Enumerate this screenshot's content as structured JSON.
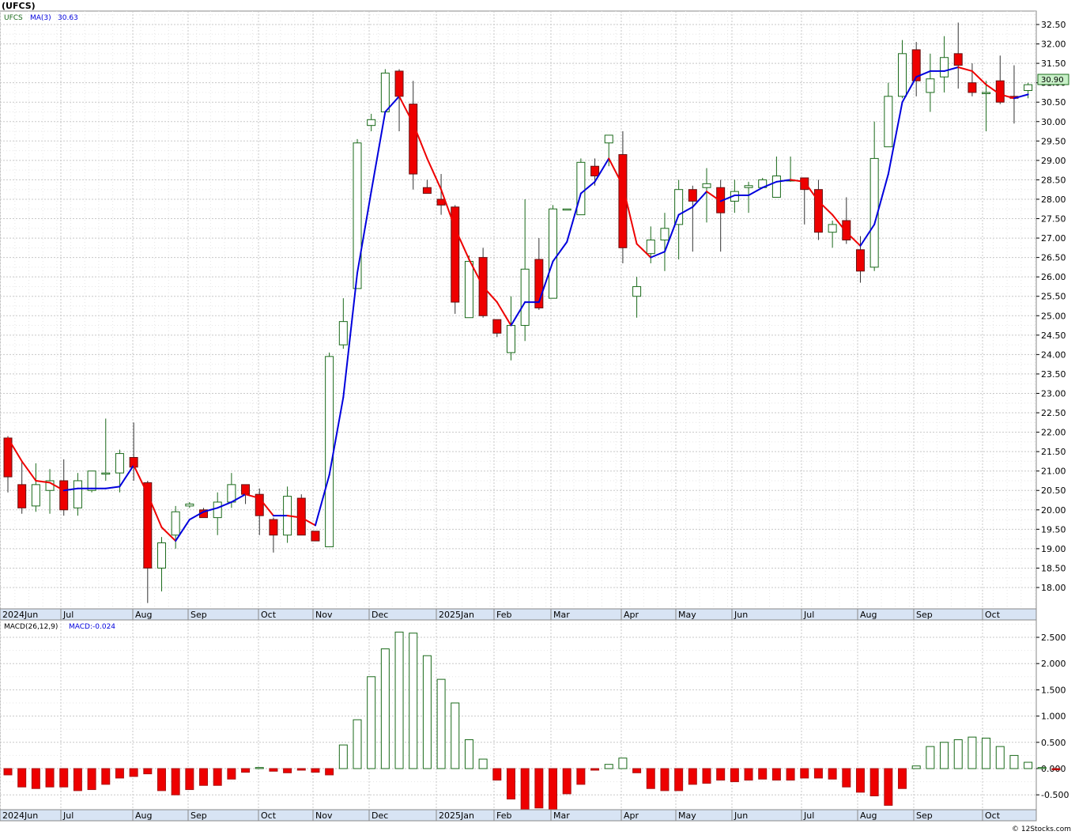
{
  "header": {
    "symbol_title": "(UFCS)"
  },
  "price_panel": {
    "legend_symbol": "UFCS",
    "ma_label": "MA(3)",
    "ma_value": "30.63",
    "last_price_label": "30.90"
  },
  "macd_panel": {
    "legend_params": "MACD(26,12,9)",
    "legend_value": "MACD:-0.024"
  },
  "footer": {
    "copyright": "© 12Stocks.com"
  },
  "colors": {
    "up_border": "#1a6a1a",
    "down_fill": "#ee0000",
    "ma_up": "#0000dd",
    "ma_down": "#ee0000",
    "grid": "#c8c8c8",
    "axis_band": "#d8e4f4",
    "last_price_bg": "#c8f0c8"
  },
  "chart_data": [
    {
      "type": "candlestick",
      "series_name": "UFCS",
      "x_labels": [
        "2024Jun",
        "Jul",
        "Aug",
        "Sep",
        "Oct",
        "Nov",
        "Dec",
        "2025Jan",
        "Feb",
        "Mar",
        "Apr",
        "May",
        "Jun",
        "Jul",
        "Aug",
        "Sep",
        "Oct"
      ],
      "y_ticks": [
        "18.00",
        "18.50",
        "19.00",
        "19.50",
        "20.00",
        "20.50",
        "21.00",
        "21.50",
        "22.00",
        "22.50",
        "23.00",
        "23.50",
        "24.00",
        "24.50",
        "25.00",
        "25.50",
        "26.00",
        "26.50",
        "27.00",
        "27.50",
        "28.00",
        "28.50",
        "29.00",
        "29.50",
        "30.00",
        "30.50",
        "31.00",
        "31.50",
        "32.00",
        "32.50"
      ],
      "ylim": [
        17.55,
        32.85
      ],
      "ohlc": [
        [
          21.85,
          21.9,
          20.45,
          20.85
        ],
        [
          20.65,
          21.25,
          19.9,
          20.05
        ],
        [
          20.1,
          21.2,
          19.95,
          20.65
        ],
        [
          20.5,
          21.05,
          19.9,
          20.75
        ],
        [
          20.75,
          21.3,
          19.85,
          20.0
        ],
        [
          20.05,
          20.95,
          19.85,
          20.75
        ],
        [
          20.5,
          21.0,
          20.45,
          21.0
        ],
        [
          20.95,
          22.35,
          20.75,
          20.95
        ],
        [
          20.95,
          21.55,
          20.45,
          21.45
        ],
        [
          21.35,
          22.25,
          20.75,
          21.1
        ],
        [
          20.7,
          20.75,
          17.6,
          18.5
        ],
        [
          18.5,
          19.3,
          17.9,
          19.15
        ],
        [
          19.35,
          20.1,
          19.0,
          19.95
        ],
        [
          20.1,
          20.2,
          20.05,
          20.15
        ],
        [
          20.0,
          20.05,
          19.8,
          19.8
        ],
        [
          19.8,
          20.45,
          19.35,
          20.2
        ],
        [
          20.2,
          20.95,
          20.05,
          20.65
        ],
        [
          20.65,
          20.65,
          20.15,
          20.4
        ],
        [
          20.4,
          20.55,
          19.35,
          19.85
        ],
        [
          19.75,
          19.8,
          18.9,
          19.35
        ],
        [
          19.35,
          20.6,
          19.15,
          20.35
        ],
        [
          20.3,
          20.4,
          19.35,
          19.35
        ],
        [
          19.45,
          19.45,
          19.2,
          19.2
        ],
        [
          19.05,
          24.05,
          19.05,
          23.95
        ],
        [
          24.25,
          25.45,
          24.15,
          24.85
        ],
        [
          25.7,
          29.55,
          25.7,
          29.45
        ],
        [
          29.9,
          30.2,
          29.75,
          30.05
        ],
        [
          30.25,
          31.35,
          30.2,
          31.25
        ],
        [
          31.3,
          31.35,
          29.75,
          30.65
        ],
        [
          30.45,
          31.05,
          28.25,
          28.65
        ],
        [
          28.3,
          28.5,
          28.15,
          28.15
        ],
        [
          28.0,
          28.65,
          27.6,
          27.85
        ],
        [
          27.8,
          27.85,
          25.05,
          25.35
        ],
        [
          24.95,
          26.55,
          24.95,
          26.4
        ],
        [
          26.5,
          26.75,
          24.95,
          25.0
        ],
        [
          24.9,
          24.9,
          24.45,
          24.55
        ],
        [
          24.05,
          25.5,
          23.85,
          24.75
        ],
        [
          24.75,
          28.0,
          24.35,
          26.2
        ],
        [
          26.45,
          27.0,
          25.15,
          25.2
        ],
        [
          25.45,
          27.85,
          25.45,
          27.75
        ],
        [
          27.75,
          27.75,
          27.75,
          27.75
        ],
        [
          27.6,
          29.05,
          27.6,
          28.95
        ],
        [
          28.85,
          29.05,
          28.35,
          28.6
        ],
        [
          29.45,
          29.65,
          28.85,
          29.65
        ],
        [
          29.15,
          29.75,
          26.35,
          26.75
        ],
        [
          25.5,
          26.0,
          24.95,
          25.75
        ],
        [
          26.6,
          27.3,
          26.35,
          26.95
        ],
        [
          26.95,
          27.65,
          26.15,
          27.25
        ],
        [
          27.35,
          28.5,
          26.45,
          28.25
        ],
        [
          28.25,
          28.35,
          26.65,
          27.95
        ],
        [
          28.3,
          28.8,
          27.4,
          28.4
        ],
        [
          28.3,
          28.5,
          26.65,
          27.65
        ],
        [
          27.95,
          28.5,
          27.65,
          28.2
        ],
        [
          28.3,
          28.45,
          27.65,
          28.35
        ],
        [
          28.3,
          28.55,
          28.3,
          28.5
        ],
        [
          28.05,
          29.1,
          28.05,
          28.6
        ],
        [
          28.5,
          29.1,
          28.45,
          28.5
        ],
        [
          28.55,
          28.55,
          27.35,
          28.25
        ],
        [
          28.25,
          28.5,
          26.95,
          27.15
        ],
        [
          27.15,
          27.45,
          26.75,
          27.35
        ],
        [
          27.45,
          28.05,
          26.85,
          26.95
        ],
        [
          26.7,
          27.05,
          25.85,
          26.15
        ],
        [
          26.25,
          30.0,
          26.15,
          29.05
        ],
        [
          29.35,
          31.0,
          29.35,
          30.65
        ],
        [
          30.65,
          32.1,
          30.6,
          31.75
        ],
        [
          31.85,
          32.05,
          30.65,
          31.05
        ],
        [
          30.75,
          31.75,
          30.25,
          31.1
        ],
        [
          31.15,
          32.2,
          30.75,
          31.65
        ],
        [
          31.75,
          32.55,
          30.85,
          31.45
        ],
        [
          31.0,
          31.5,
          30.65,
          30.75
        ],
        [
          30.75,
          31.05,
          29.75,
          30.75
        ],
        [
          31.05,
          31.7,
          30.45,
          30.5
        ],
        [
          30.65,
          31.45,
          29.95,
          30.6
        ],
        [
          30.8,
          31.0,
          30.6,
          30.95
        ]
      ],
      "ma3": [
        21.85,
        21.25,
        20.75,
        20.7,
        20.5,
        20.55,
        20.55,
        20.55,
        20.6,
        21.15,
        20.4,
        19.55,
        19.2,
        19.75,
        19.95,
        20.05,
        20.2,
        20.4,
        20.3,
        19.85,
        19.85,
        19.8,
        19.6,
        20.9,
        22.9,
        26.1,
        28.2,
        30.25,
        30.65,
        29.95,
        29.05,
        28.25,
        27.25,
        26.45,
        25.75,
        25.35,
        24.75,
        25.35,
        25.35,
        26.4,
        26.9,
        28.15,
        28.45,
        29.05,
        28.35,
        26.85,
        26.5,
        26.65,
        27.6,
        27.8,
        28.2,
        27.95,
        28.1,
        28.1,
        28.3,
        28.45,
        28.5,
        28.45,
        27.95,
        27.6,
        27.15,
        26.8,
        27.35,
        28.65,
        30.5,
        31.15,
        31.3,
        31.3,
        31.4,
        31.3,
        30.95,
        30.7,
        30.6,
        30.7
      ]
    },
    {
      "type": "bar",
      "series_name": "MACD(26,12,9)",
      "y_ticks": [
        "-0.500",
        "0.000",
        "0.500",
        "1.000",
        "1.500",
        "2.000",
        "2.500"
      ],
      "ylim": [
        -0.8,
        2.75
      ],
      "values": [
        -0.12,
        -0.35,
        -0.38,
        -0.35,
        -0.35,
        -0.42,
        -0.4,
        -0.3,
        -0.18,
        -0.15,
        -0.1,
        -0.42,
        -0.5,
        -0.4,
        -0.32,
        -0.32,
        -0.2,
        -0.07,
        0.02,
        -0.05,
        -0.08,
        -0.03,
        -0.07,
        -0.12,
        0.45,
        0.93,
        1.75,
        2.28,
        2.6,
        2.58,
        2.15,
        1.7,
        1.25,
        0.55,
        0.18,
        -0.22,
        -0.58,
        -0.78,
        -0.75,
        -0.8,
        -0.48,
        -0.3,
        -0.03,
        0.08,
        0.2,
        -0.08,
        -0.38,
        -0.42,
        -0.42,
        -0.3,
        -0.28,
        -0.22,
        -0.25,
        -0.22,
        -0.2,
        -0.22,
        -0.22,
        -0.18,
        -0.18,
        -0.2,
        -0.35,
        -0.45,
        -0.52,
        -0.7,
        -0.38,
        0.05,
        0.42,
        0.5,
        0.55,
        0.6,
        0.58,
        0.42,
        0.25,
        0.12,
        0.02,
        -0.024
      ]
    }
  ]
}
